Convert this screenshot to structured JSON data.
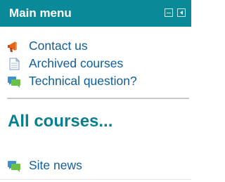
{
  "block": {
    "title": "Main menu"
  },
  "menu": {
    "items": [
      {
        "label": "Contact us",
        "icon": "megaphone-icon"
      },
      {
        "label": "Archived courses",
        "icon": "document-icon"
      },
      {
        "label": "Technical question?",
        "icon": "forum-icon"
      }
    ]
  },
  "all_courses": {
    "label": "All courses..."
  },
  "site_news": {
    "label": "Site news",
    "icon": "forum-icon"
  },
  "colors": {
    "header_bg": "#0a8a99",
    "link": "#0f5e9a",
    "heading_link": "#0a7f8d"
  }
}
